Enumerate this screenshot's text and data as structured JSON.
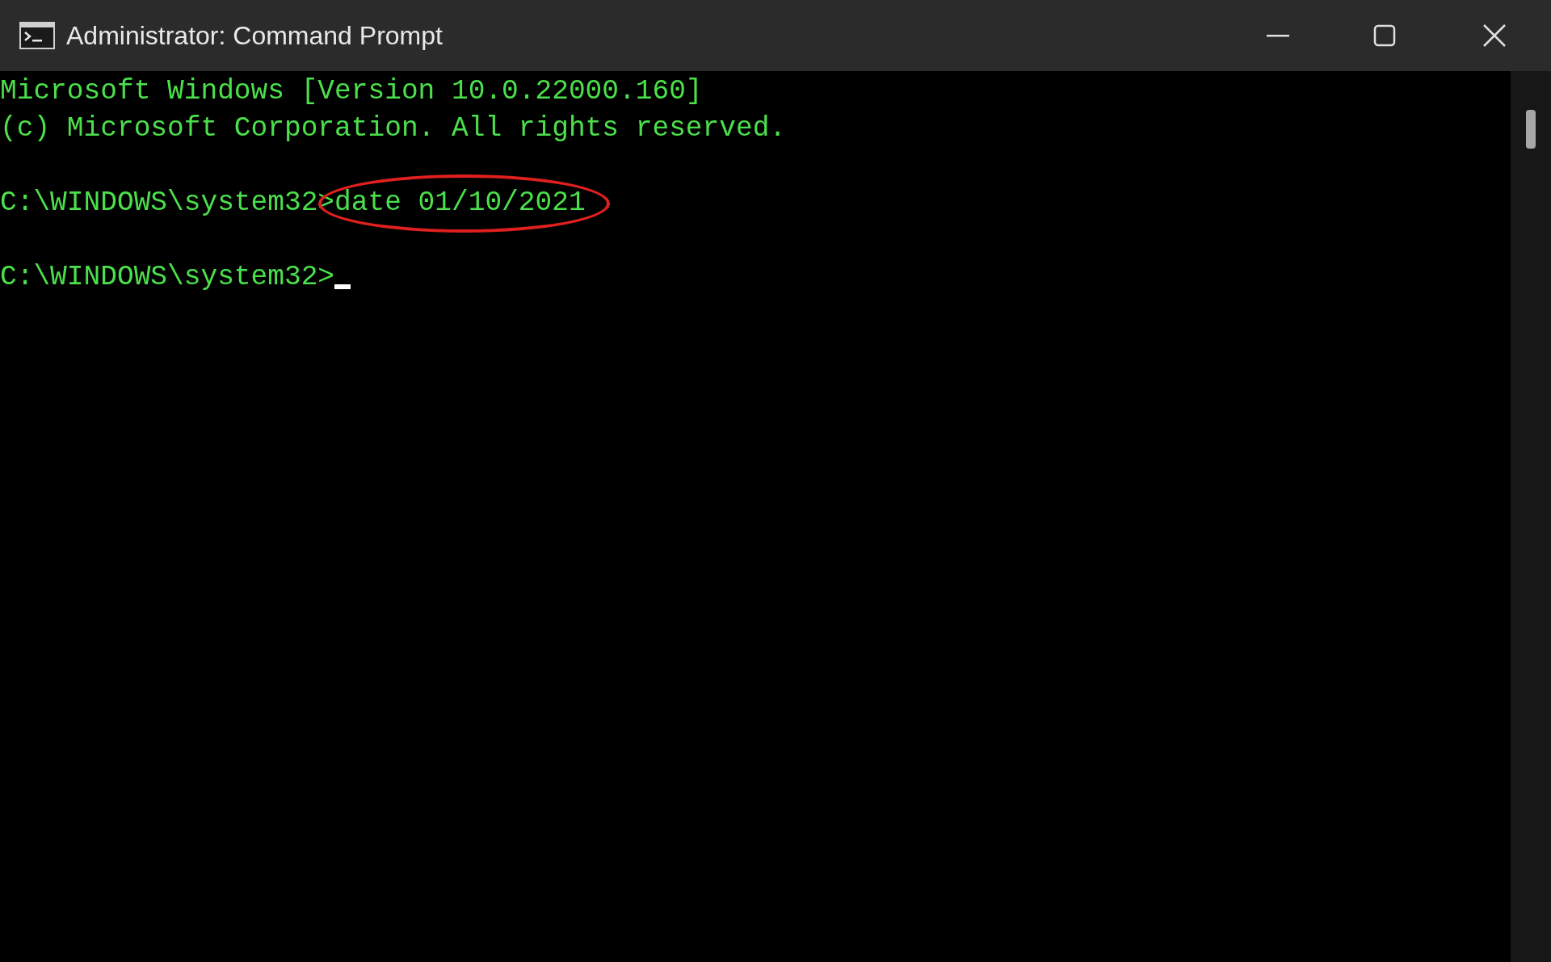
{
  "window": {
    "title": "Administrator: Command Prompt"
  },
  "console": {
    "lines": [
      {
        "kind": "output",
        "text": "Microsoft Windows [Version 10.0.22000.160]"
      },
      {
        "kind": "output",
        "text": "(c) Microsoft Corporation. All rights reserved."
      },
      {
        "kind": "blank"
      },
      {
        "kind": "prompt",
        "prompt": "C:\\WINDOWS\\system32>",
        "command": "date 01/10/2021",
        "highlighted": true
      },
      {
        "kind": "blank"
      },
      {
        "kind": "prompt",
        "prompt": "C:\\WINDOWS\\system32>",
        "cursor": true
      }
    ]
  }
}
